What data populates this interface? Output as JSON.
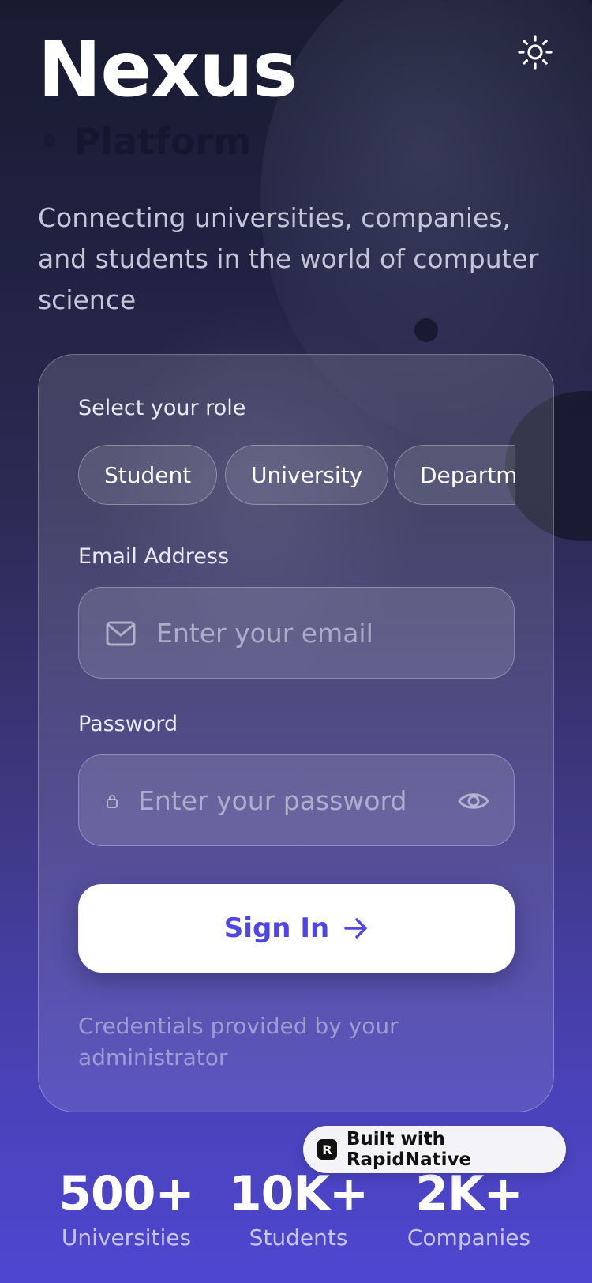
{
  "app": {
    "title": "Nexus",
    "subtitle": "Platform",
    "tagline": "Connecting universities, companies, and students in the world of computer science"
  },
  "header": {
    "theme_icon": "sun-icon"
  },
  "login": {
    "role_label": "Select your role",
    "roles": [
      "Student",
      "University",
      "Department"
    ],
    "email": {
      "label": "Email Address",
      "placeholder": "Enter your email",
      "icon": "mail-icon"
    },
    "password": {
      "label": "Password",
      "placeholder": "Enter your password",
      "icon": "lock-icon",
      "toggle_icon": "eye-icon"
    },
    "submit_label": "Sign In",
    "submit_icon": "arrow-right-icon",
    "note": "Credentials provided by your administrator"
  },
  "badge": {
    "text": "Built with RapidNative",
    "logo": "R"
  },
  "stats": [
    {
      "value": "500+",
      "label": "Universities"
    },
    {
      "value": "10K+",
      "label": "Students"
    },
    {
      "value": "2K+",
      "label": "Companies"
    }
  ],
  "colors": {
    "accent": "#4f46e5",
    "background_top": "#181b30",
    "background_bottom": "#4e46d0"
  }
}
